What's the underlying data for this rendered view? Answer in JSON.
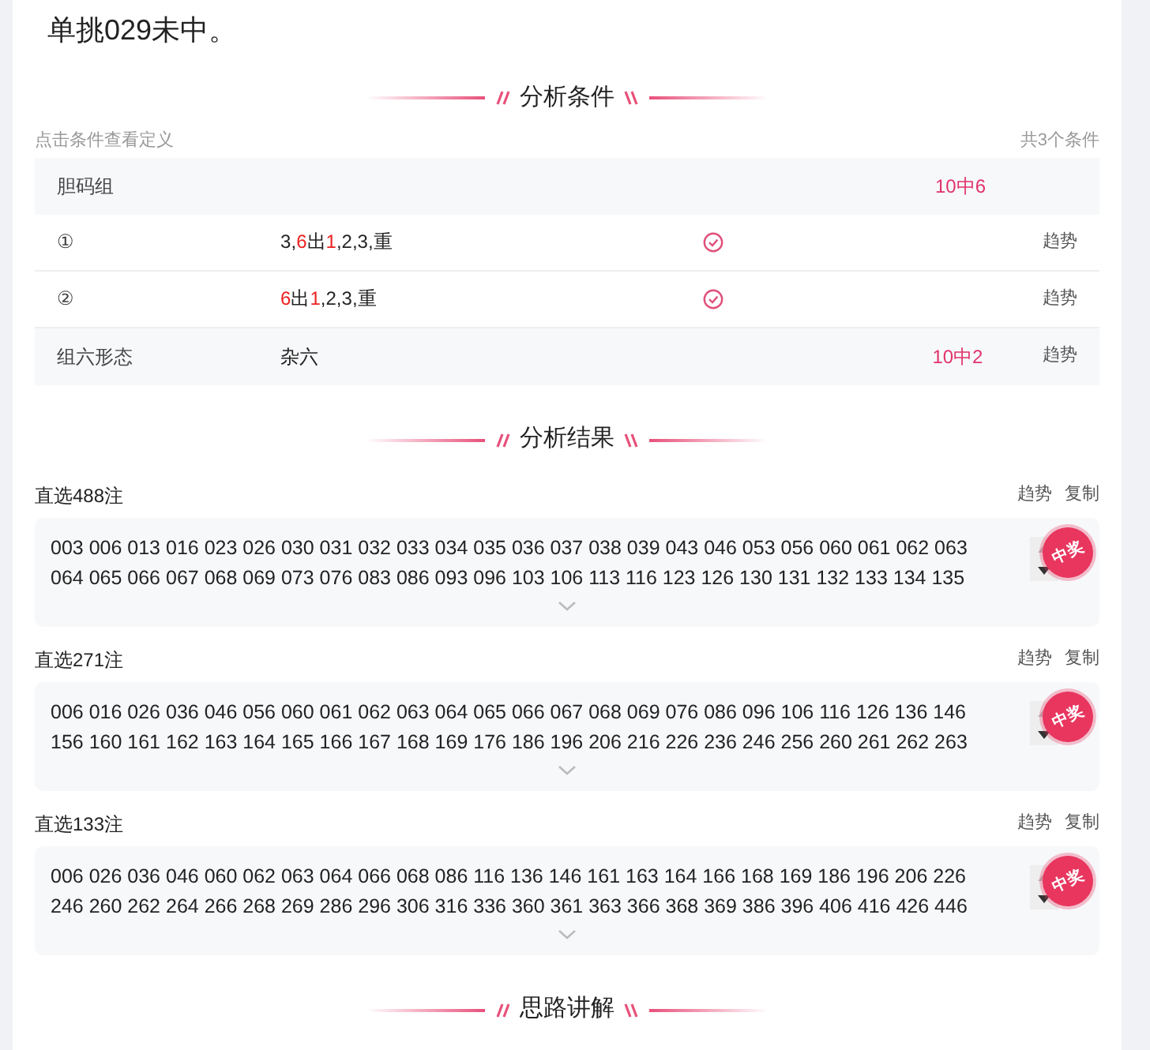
{
  "headline": "单挑029未中。",
  "conditions_section": {
    "title": "分析条件",
    "hint": "点击条件查看定义",
    "count": "共3个条件",
    "rows": [
      {
        "kind": "group",
        "name": "胆码组",
        "value": [],
        "passed": false,
        "hit": "10中6",
        "trend": ""
      },
      {
        "kind": "item",
        "name": "①",
        "value": [
          {
            "text": "3,",
            "highlight": false
          },
          {
            "text": "6",
            "highlight": true
          },
          {
            "text": "出",
            "highlight": false
          },
          {
            "text": "1",
            "highlight": true
          },
          {
            "text": ",2,3,重",
            "highlight": false
          }
        ],
        "passed": true,
        "hit": "",
        "trend": "趋势"
      },
      {
        "kind": "item",
        "name": "②",
        "value": [
          {
            "text": "6",
            "highlight": true
          },
          {
            "text": "出",
            "highlight": false
          },
          {
            "text": "1",
            "highlight": true
          },
          {
            "text": ",2,3,重",
            "highlight": false
          }
        ],
        "passed": true,
        "hit": "",
        "trend": "趋势"
      },
      {
        "kind": "group",
        "name": "组六形态",
        "value": [
          {
            "text": "杂六",
            "highlight": false
          }
        ],
        "passed": false,
        "hit": "10中2",
        "trend": "趋势"
      }
    ]
  },
  "results_section": {
    "title": "分析结果",
    "results": [
      {
        "title": "直选488注",
        "trend": "趋势",
        "copy": "复制",
        "stamp": "中奖",
        "lines": [
          "003 006 013 016 023 026 030 031 032 033 034 035 036 037 038 039 043 046 053 056 060 061 062 063",
          "064 065 066 067 068 069 073 076 083 086 093 096 103 106 113 116 123 126 130 131 132 133 134 135"
        ]
      },
      {
        "title": "直选271注",
        "trend": "趋势",
        "copy": "复制",
        "stamp": "中奖",
        "lines": [
          "006 016 026 036 046 056 060 061 062 063 064 065 066 067 068 069 076 086 096 106 116 126 136 146",
          "156 160 161 162 163 164 165 166 167 168 169 176 186 196 206 216 226 236 246 256 260 261 262 263"
        ]
      },
      {
        "title": "直选133注",
        "trend": "趋势",
        "copy": "复制",
        "stamp": "中奖",
        "lines": [
          "006 026 036 046 060 062 063 064 066 068 086 116 136 146 161 163 164 166 168 169 186 196 206 226",
          "246 260 262 264 266 268 269 286 296 306 316 336 360 361 363 366 368 369 386 396 406 416 426 446"
        ]
      }
    ]
  },
  "reasoning_section": {
    "title": "思路讲解"
  }
}
